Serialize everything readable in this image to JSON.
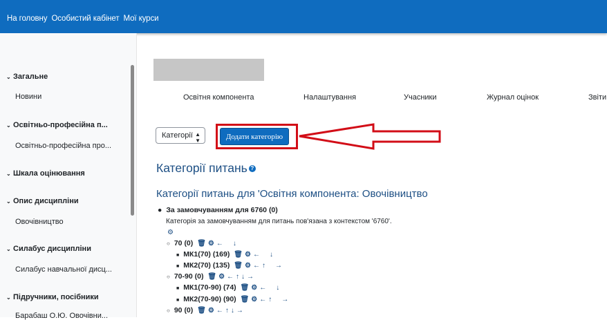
{
  "topnav": {
    "items": [
      "На головну",
      "Особистий кабінет",
      "Мої курси"
    ]
  },
  "drawer": {
    "sections": [
      {
        "title": "Загальне",
        "item": "Новини"
      },
      {
        "title": "Освітньо-професійна п...",
        "item": "Освітньо-професійна про..."
      },
      {
        "title": "Шкала оцінювання",
        "item": ""
      },
      {
        "title": "Опис дисципліни",
        "item": "Овочівництво"
      },
      {
        "title": "Силабус дисципліни",
        "item": "Силабус навчальної дисц..."
      },
      {
        "title": "Підручники, посібники",
        "item": "Барабаш О.Ю. Овочівни..."
      }
    ]
  },
  "tabs": [
    "Освітня компонента",
    "Налаштування",
    "Учасники",
    "Журнал оцінок",
    "Звіти"
  ],
  "toolbar": {
    "select_value": "Категорії",
    "add_label": "Додати категорію"
  },
  "headings": {
    "page_title": "Категорії питань",
    "context_title": "Категорії питань для 'Освітня компонента: Овочівництво"
  },
  "categories": {
    "default": {
      "label": "За замовчуванням для 6760 (0)",
      "desc": "Категорія за замовчуванням для питань пов'язана з контекстом '6760'."
    },
    "c1": "70 (0)",
    "c1a": "МК1(70) (169)",
    "c1b": "МК2(70) (135)",
    "c2": "70-90 (0)",
    "c2a": "МК1(70-90) (74)",
    "c2b": "МК2(70-90) (90)",
    "c3": "90 (0)"
  },
  "colors": {
    "brand": "#0f6cbf",
    "heading": "#1d4f84",
    "annotation": "#d20d17"
  }
}
